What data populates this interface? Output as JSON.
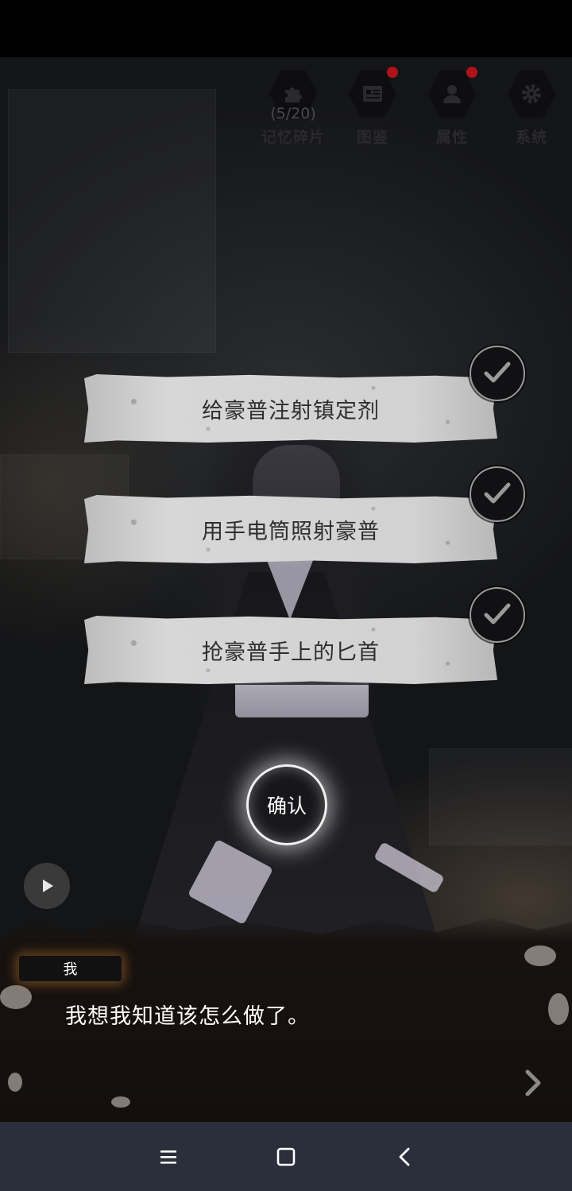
{
  "top_menu": {
    "memory_fragments": {
      "label": "记忆碎片",
      "count": "(5/20)"
    },
    "codex": {
      "label": "图鉴"
    },
    "attributes": {
      "label": "属性"
    },
    "system": {
      "label": "系统"
    }
  },
  "choices": [
    {
      "label": "给豪普注射镇定剂"
    },
    {
      "label": "用手电筒照射豪普"
    },
    {
      "label": "抢豪普手上的匕首"
    }
  ],
  "confirm_label": "确认",
  "dialog": {
    "speaker": "我",
    "text": "我想我知道该怎么做了。"
  },
  "colors": {
    "notification_dot": "#b0121a",
    "nav_bar": "#2b2f3c",
    "speaker_glow": "#be7832"
  },
  "icons": {
    "memory_fragments": "puzzle-icon",
    "codex": "card-icon",
    "attributes": "person-icon",
    "system": "gear-icon",
    "choice_check": "check-icon",
    "play": "play-icon",
    "next": "chevron-right-icon",
    "nav_recents": "menu-icon",
    "nav_home": "square-icon",
    "nav_back": "back-icon"
  }
}
